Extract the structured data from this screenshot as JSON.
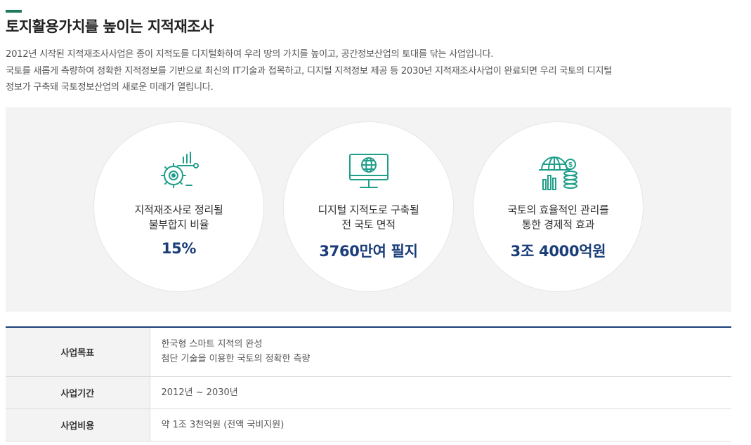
{
  "page": {
    "title": "토지활용가치를 높이는 지적재조사",
    "intro": [
      "2012년 시작된 지적재조사사업은 종이 지적도를 디지털화하여 우리 땅의 가치를 높이고, 공간정보산업의 토대를 닦는 사업입니다.",
      "국토를 새롭게 측량하여 정확한 지적정보를 기반으로 최신의 IT기술과 접목하고, 디지털 지적정보 제공 등 2030년 지적재조사사업이 완료되면 우리 국토의 디지털",
      "정보가 구축돼 국토정보산업의 새로운 미래가 열립니다."
    ]
  },
  "stats": [
    {
      "icon": "gear-chart-icon",
      "label_line1": "지적재조사로 정리될",
      "label_line2": "불부합지 비율",
      "value": "15%"
    },
    {
      "icon": "monitor-globe-icon",
      "label_line1": "디지털 지적도로 구축될",
      "label_line2": "전 국토 면적",
      "value": "3760만여 필지"
    },
    {
      "icon": "globe-coins-icon",
      "label_line1": "국토의 효율적인 관리를",
      "label_line2": "통한 경제적 효과",
      "value": "3조 4000억원"
    }
  ],
  "table": {
    "rows": [
      {
        "header": "사업목표",
        "lines": [
          "한국형 스마트 지적의 완성",
          "첨단 기술을 이용한 국토의 정확한 측량"
        ]
      },
      {
        "header": "사업기간",
        "lines": [
          "2012년 ~ 2030년"
        ]
      },
      {
        "header": "사업비용",
        "lines": [
          "약 1조 3천억원 (전액 국비지원)"
        ]
      }
    ]
  },
  "colors": {
    "accent_green": "#1e7a57",
    "value_navy": "#1b3e79",
    "icon_teal": "#1f9e8a",
    "panel_gray": "#f3f3f3"
  }
}
